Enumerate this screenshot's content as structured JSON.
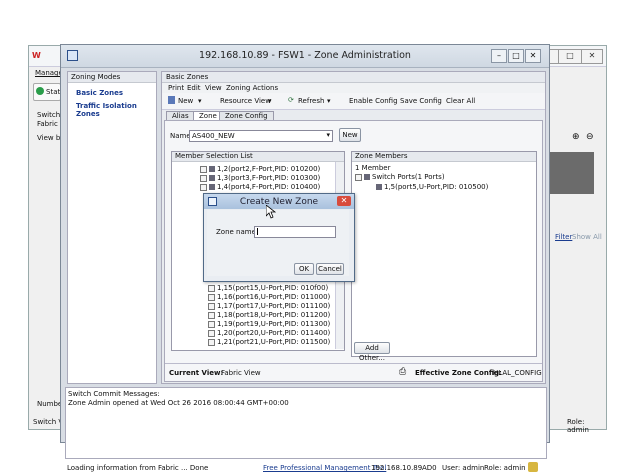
{
  "back_window": {
    "menu_manage": "Manage",
    "menu_stat": "Stat",
    "switch_label": "Switch V",
    "fabric_label": "Fabric Tr",
    "viewby_label": "View by",
    "number_label": "Number",
    "status_switchview": "Switch Vie",
    "filter_link": "Filter",
    "show_all_link": "Show All",
    "status_role": "Role: admin"
  },
  "main": {
    "title": "192.168.10.89 - FSW1 - Zone Administration",
    "left_header": "Zoning Modes",
    "left_items": [
      "Basic Zones",
      "Traffic Isolation Zones"
    ],
    "content_header": "Basic Zones",
    "menu": [
      "Print",
      "Edit",
      "View",
      "Zoning Actions"
    ],
    "toolbar": {
      "new": "New",
      "resource_view": "Resource View",
      "refresh": "Refresh",
      "enable_config": "Enable Config",
      "save_config": "Save Config",
      "clear_all": "Clear All"
    },
    "tabs": [
      "Alias",
      "Zone",
      "Zone Config"
    ],
    "name_label": "Name",
    "name_value": "AS400_NEW",
    "name_new_button": "New",
    "member_list_header": "Member Selection List",
    "member_rows_top": [
      "1,2(port2,F-Port,PID: 010200)",
      "1,3(port3,F-Port,PID: 010300)",
      "1,4(port4,F-Port,PID: 010400)"
    ],
    "member_rows_bottom": [
      "1,15(port15,U-Port,PID: 010f00)",
      "1,16(port16,U-Port,PID: 011000)",
      "1,17(port17,U-Port,PID: 011100)",
      "1,18(port18,U-Port,PID: 011200)",
      "1,19(port19,U-Port,PID: 011300)",
      "1,20(port20,U-Port,PID: 011400)",
      "1,21(port21,U-Port,PID: 011500)"
    ],
    "zone_members_header": "Zone Members",
    "zone_members_count": "1 Member",
    "zone_tree_root": "Switch Ports(1 Ports)",
    "zone_tree_child": "1,5(port5,U-Port,PID: 010500)",
    "add_other_button": "Add Other...",
    "current_view_label": "Current View:",
    "current_view_value": "Fabric View",
    "effective_label": "Effective Zone Config:",
    "effective_value": "HLAL_CONFIG",
    "messages_label": "Switch Commit Messages:",
    "messages_text": "Zone Admin opened at Wed Oct 26 2016 08:00:44 GMT+00:00",
    "status": {
      "loading": "Loading information from Fabric ... Done",
      "tool_link": "Free Professional Management Tool",
      "ip": "192.168.10.89",
      "ad": "AD0",
      "user": "User: admin",
      "role": "Role: admin"
    }
  },
  "dialog": {
    "title": "Create New Zone",
    "zone_name_label": "Zone name",
    "zone_name_value": "",
    "ok_button": "OK",
    "cancel_button": "Cancel"
  },
  "colors": {
    "accent": "#1a3c8f",
    "dialog_title": "#a9c1dd",
    "close_red": "#d84b3c"
  }
}
